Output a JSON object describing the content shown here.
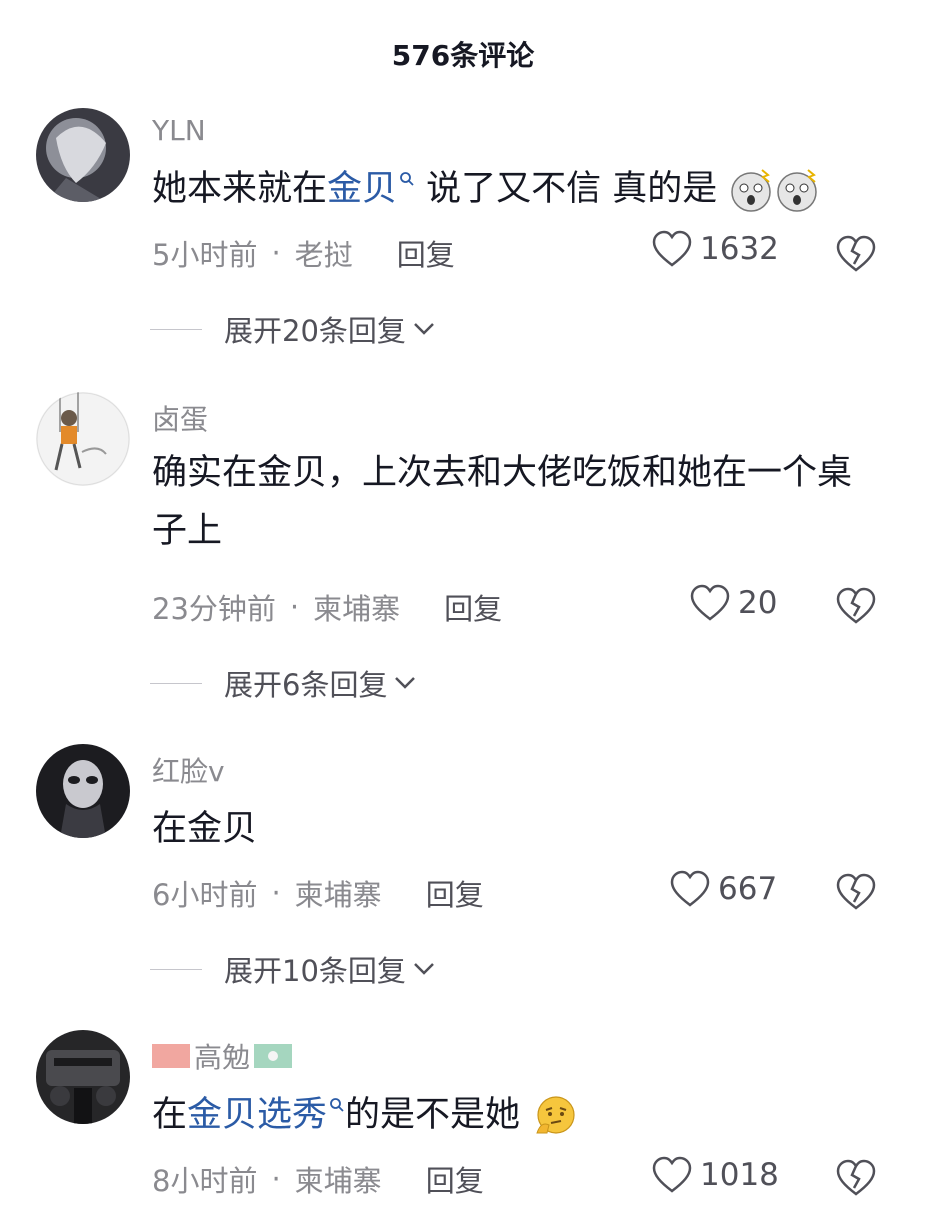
{
  "header": {
    "title": "576条评论"
  },
  "comments": [
    {
      "username": "YLN",
      "text_a": "她本来就在",
      "link_a": "金贝",
      "text_b": " 说了又不信 真的是",
      "time": "5小时前",
      "location": "老挝",
      "reply_label": "回复",
      "likes": "1632",
      "expand": "展开20条回复"
    },
    {
      "username": "卤蛋",
      "text": "确实在金贝，上次去和大佬吃饭和她在一个桌子上",
      "time": "23分钟前",
      "location": "柬埔寨",
      "reply_label": "回复",
      "likes": "20",
      "expand": "展开6条回复"
    },
    {
      "username": "红脸v",
      "text": "在金贝",
      "time": "6小时前",
      "location": "柬埔寨",
      "reply_label": "回复",
      "likes": "667",
      "expand": "展开10条回复"
    },
    {
      "username": "高勉",
      "text_a": "在",
      "link_a": "金贝选秀",
      "text_b": "的是不是她",
      "time": "8小时前",
      "location": "柬埔寨",
      "reply_label": "回复",
      "likes": "1018"
    }
  ],
  "colors": {
    "link": "#2b5ba6",
    "muted": "#8a8a8f",
    "text": "#161823"
  },
  "icons": [
    "heart-icon",
    "broken-heart-icon",
    "search-icon",
    "chevron-down-icon",
    "shocked-emoji",
    "thinking-emoji"
  ]
}
